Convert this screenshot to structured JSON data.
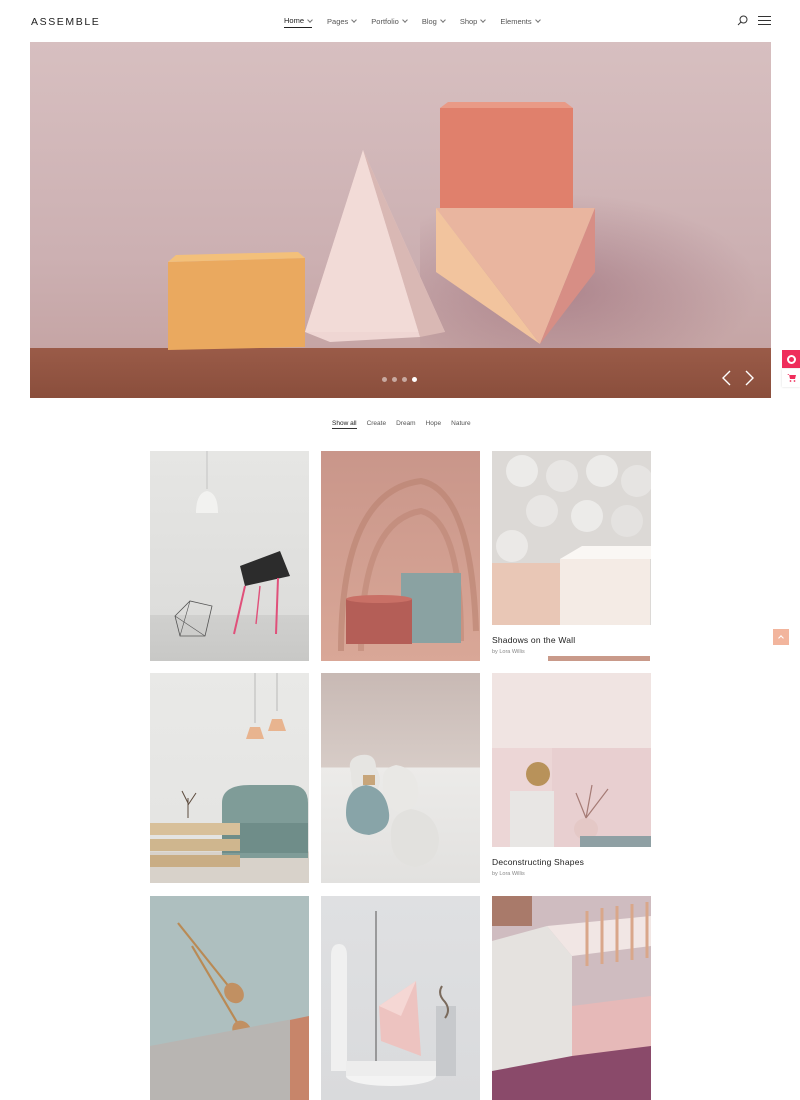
{
  "brand": {
    "logo": "ASSEMBLE"
  },
  "nav": {
    "items": [
      {
        "label": "Home",
        "active": true
      },
      {
        "label": "Pages",
        "active": false
      },
      {
        "label": "Portfolio",
        "active": false
      },
      {
        "label": "Blog",
        "active": false
      },
      {
        "label": "Shop",
        "active": false
      },
      {
        "label": "Elements",
        "active": false
      }
    ]
  },
  "header": {
    "search_icon": "search-icon",
    "menu_icon": "hamburger-menu-icon"
  },
  "hero": {
    "slides": 4,
    "active_slide": 4,
    "prev_icon": "chevron-left-icon",
    "next_icon": "chevron-right-icon"
  },
  "filters": {
    "items": [
      {
        "label": "Show all",
        "active": true
      },
      {
        "label": "Create",
        "active": false
      },
      {
        "label": "Dream",
        "active": false
      },
      {
        "label": "Hope",
        "active": false
      },
      {
        "label": "Nature",
        "active": false
      }
    ]
  },
  "portfolio": {
    "items": [
      {
        "title": "Shadows on the Wall",
        "author": "by Lora Willis"
      },
      {
        "title": "Deconstructing Shapes",
        "author": "by Lora Willis"
      }
    ]
  },
  "widgets": {
    "side_icon": "ring-icon",
    "cart_icon": "cart-icon",
    "back_to_top_icon": "arrow-up-icon"
  },
  "colors": {
    "accent": "#ef2e5c",
    "back_to_top": "#f2b59d"
  }
}
